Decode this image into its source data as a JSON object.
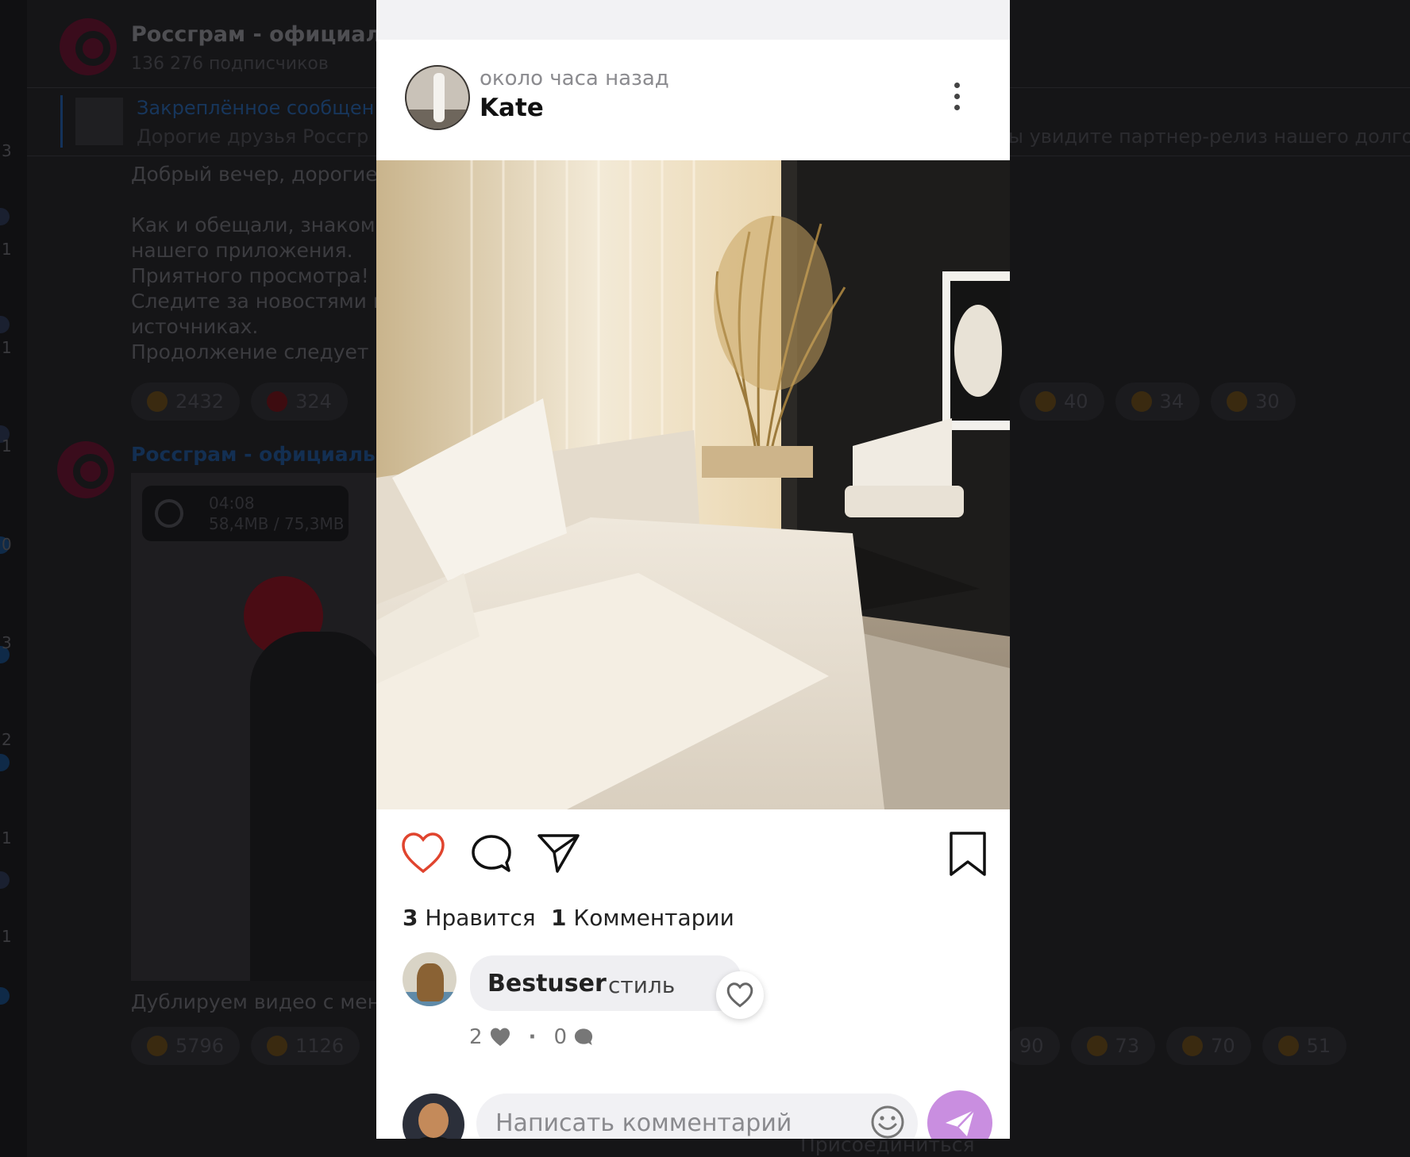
{
  "background": {
    "channel_title": "Россграм - официальн",
    "channel_subscribers": "136 276 подписчиков",
    "pinned_title": "Закреплённое сообщен",
    "pinned_text": "Дорогие друзья Россгр",
    "pinned_text_right": "ы увидите партнер-релиз нашего долго",
    "message_text": "Добрый вечер, дорогие\n\nКак и обещали, знакоми\nнашего приложения.\nПриятного просмотра!\nСледите за новостями в\nисточниках.\nПродолжение следует",
    "reactions_row1_left": [
      {
        "emoji": "thumbs-up",
        "count": "2432"
      },
      {
        "emoji": "heart",
        "count": "324"
      }
    ],
    "reactions_row1_right": [
      {
        "emoji": "scream",
        "count": "40"
      },
      {
        "emoji": "clap",
        "count": "34"
      },
      {
        "emoji": "party",
        "count": "30"
      }
    ],
    "second_post_title": "Россграм - официально",
    "video_duration": "04:08",
    "video_size": "58,4MB / 75,3MB",
    "video_caption": "Дублируем видео с мен",
    "reactions_row2_left": [
      {
        "emoji": "thumbs-up",
        "count": "5796"
      },
      {
        "emoji": "thumbs-down",
        "count": "1126"
      }
    ],
    "reactions_row2_right": [
      {
        "emoji": "unknown",
        "count": "90"
      },
      {
        "emoji": "exploding-head",
        "count": "73"
      },
      {
        "emoji": "grin",
        "count": "70"
      },
      {
        "emoji": "scream",
        "count": "51"
      }
    ],
    "left_numbers": [
      "3",
      "1",
      "1",
      "1",
      "0",
      "3",
      "2",
      "1",
      "1"
    ],
    "join_text": "Присоединиться"
  },
  "post": {
    "time": "около часа назад",
    "author": "Kate",
    "likes_count": "3",
    "likes_label": "Нравится",
    "comments_count": "1",
    "comments_label": "Комментарии",
    "comment": {
      "user": "Bestuser",
      "text": "стиль",
      "likes": "2",
      "replies": "0"
    },
    "input_placeholder": "Написать комментарий",
    "like_icon_color": "#e0442e",
    "send_button_color": "#c98ee0"
  }
}
